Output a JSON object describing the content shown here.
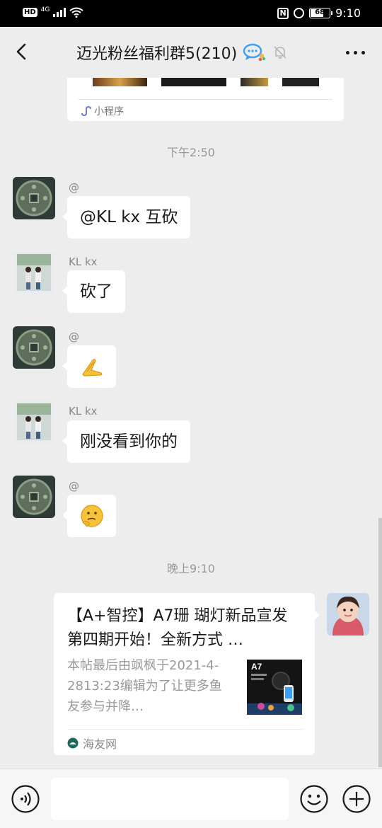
{
  "status_bar": {
    "hd_badge": "HD",
    "network": "4G",
    "battery": "68",
    "battery_level": 0.68,
    "time": "9:10"
  },
  "header": {
    "title": "迈光粉丝福利群5(210)",
    "icons": [
      "back-chevron-icon",
      "group-chat-icon",
      "mute-bell-icon",
      "more-icon"
    ]
  },
  "top_card": {
    "mini_program_label": "小程序"
  },
  "messages": [
    {
      "type": "time",
      "text": "下午2:50"
    },
    {
      "type": "text",
      "sender": "@",
      "avatar": "coin",
      "text": "@KL kx  互砍"
    },
    {
      "type": "text",
      "sender": "KL kx",
      "avatar": "kids",
      "text": "砍了"
    },
    {
      "type": "emoji",
      "sender": "@",
      "avatar": "coin",
      "emoji": "🙏"
    },
    {
      "type": "text",
      "sender": "KL kx",
      "avatar": "kids",
      "text": "刚没看到你的"
    },
    {
      "type": "emoji",
      "sender": "@",
      "avatar": "coin",
      "emoji": "🤔"
    },
    {
      "type": "time",
      "text": "晚上9:10"
    }
  ],
  "link_card": {
    "title": "【A+智控】A7珊 瑚灯新品宣发  第四期开始！全新方式 …",
    "description": "本帖最后由飒枫于2021-4-2813:23编辑为了让更多鱼友参与并降…",
    "thumb_text": "A7",
    "source": "海友网"
  },
  "input_bar": {
    "placeholder": "",
    "icons": [
      "voice-icon",
      "emoji-icon",
      "plus-icon"
    ]
  },
  "colors": {
    "background": "#ededed",
    "bubble": "#ffffff",
    "accent_blue": "#3a9ff5",
    "status_bar": "#000000"
  }
}
